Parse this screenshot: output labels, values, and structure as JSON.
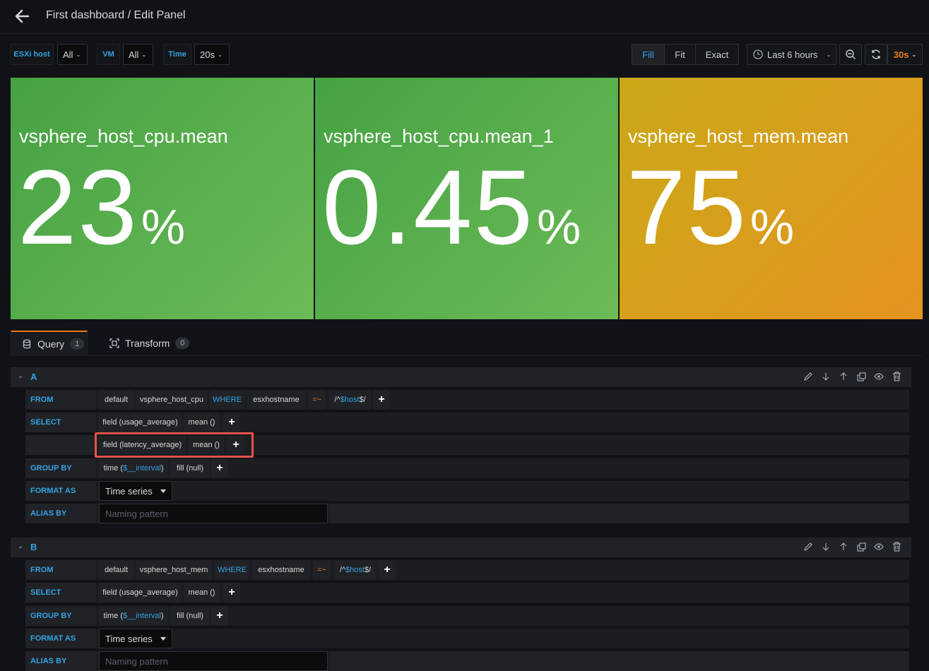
{
  "header": {
    "title": "First dashboard / Edit Panel"
  },
  "variables": [
    {
      "label": "ESXi host",
      "value": "All"
    },
    {
      "label": "VM",
      "value": "All"
    },
    {
      "label": "Time",
      "value": "20s"
    }
  ],
  "toolbar": {
    "fill": "Fill",
    "fit": "Fit",
    "exact": "Exact",
    "time_range": "Last 6 hours",
    "refresh": "30s"
  },
  "stats": [
    {
      "name": "vsphere_host_cpu.mean",
      "value": "23",
      "unit": "%"
    },
    {
      "name": "vsphere_host_cpu.mean_1",
      "value": "0.45",
      "unit": "%"
    },
    {
      "name": "vsphere_host_mem.mean",
      "value": "75",
      "unit": "%"
    }
  ],
  "colors": {
    "green": "#56a64b",
    "orange": "#e0a31d",
    "accent": "#33a2e5"
  },
  "tabs": [
    {
      "label": "Query",
      "count": "1"
    },
    {
      "label": "Transform",
      "count": "0"
    }
  ],
  "queryA": {
    "letter": "A",
    "from": {
      "label": "FROM",
      "policy": "default",
      "measurement": "vsphere_host_cpu",
      "where": "WHERE",
      "key": "esxhostname",
      "op": "=~",
      "val_pre": "/^",
      "val_var": "$host",
      "val_post": "$/"
    },
    "select1": {
      "label": "SELECT",
      "field": "field (usage_average)",
      "fn": "mean ()"
    },
    "select2": {
      "field": "field (latency_average)",
      "fn": "mean ()"
    },
    "group": {
      "label": "GROUP BY",
      "time_pre": "time (",
      "time_var": "$__interval",
      "time_post": ")",
      "fill": "fill (null)"
    },
    "format": {
      "label": "FORMAT AS",
      "value": "Time series"
    },
    "alias": {
      "label": "ALIAS BY",
      "placeholder": "Naming pattern"
    }
  },
  "queryB": {
    "letter": "B",
    "from": {
      "label": "FROM",
      "policy": "default",
      "measurement": "vsphere_host_mem",
      "where": "WHERE",
      "key": "esxhostname",
      "op": "=~",
      "val_pre": "/^",
      "val_var": "$host",
      "val_post": "$/"
    },
    "select1": {
      "label": "SELECT",
      "field": "field (usage_average)",
      "fn": "mean ()"
    },
    "group": {
      "label": "GROUP BY",
      "time_pre": "time (",
      "time_var": "$__interval",
      "time_post": ")",
      "fill": "fill (null)"
    },
    "format": {
      "label": "FORMAT AS",
      "value": "Time series"
    },
    "alias": {
      "label": "ALIAS BY",
      "placeholder": "Naming pattern"
    }
  }
}
